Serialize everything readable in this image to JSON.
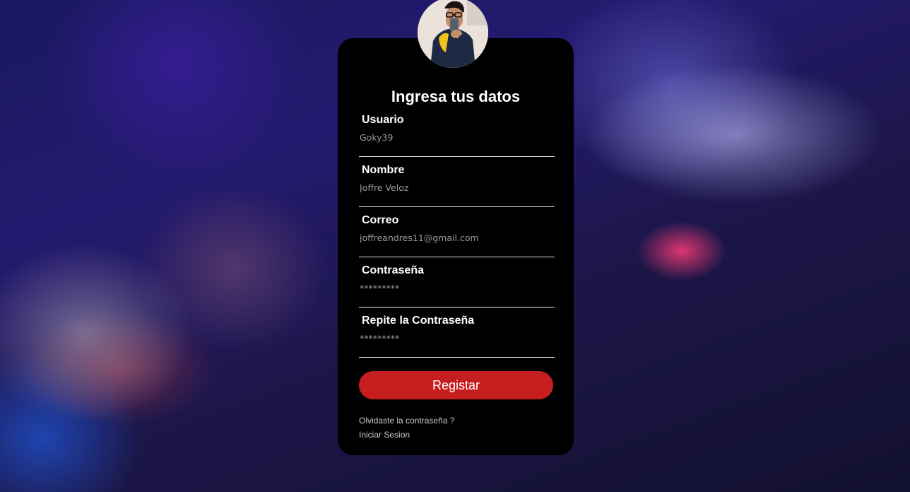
{
  "form": {
    "title": "Ingresa tus datos",
    "fields": [
      {
        "label": "Usuario",
        "value": "Goky39"
      },
      {
        "label": "Nombre",
        "value": "Joffre Veloz"
      },
      {
        "label": "Correo",
        "value": "joffreandres11@gmail.com"
      },
      {
        "label": "Contraseña",
        "value": "*********"
      },
      {
        "label": "Repite la Contraseña",
        "value": "*********"
      }
    ],
    "submit_label": "Registar",
    "forgot_link": "Olvidaste la contraseña ?",
    "login_link": "Iniciar Sesion"
  },
  "colors": {
    "card_bg": "#000000",
    "button_bg": "#c61d1f",
    "text": "#ffffff"
  }
}
